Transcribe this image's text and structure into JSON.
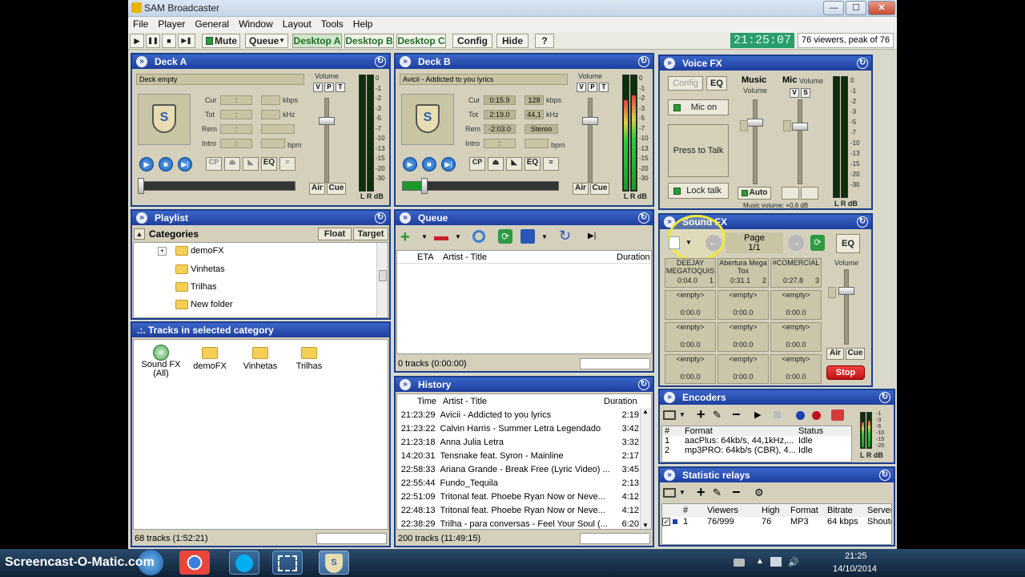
{
  "app": {
    "title": "SAM Broadcaster"
  },
  "window_controls": {
    "minimize": "—",
    "maximize": "☐",
    "close": "✕"
  },
  "menu": [
    "File",
    "Player",
    "General",
    "Window",
    "Layout",
    "Tools",
    "Help"
  ],
  "toolbar": {
    "play": "▶",
    "pause": "❚❚",
    "stop": "■",
    "next": "▶❚",
    "mute": "Mute",
    "queue": "Queue",
    "desktop_a": "Desktop A",
    "desktop_b": "Desktop B",
    "desktop_c": "Desktop C",
    "config": "Config",
    "hide": "Hide",
    "help": "?",
    "clock": "21:25:07",
    "viewers": "76 viewers, peak of 76"
  },
  "deck_a": {
    "title": "Deck A",
    "track": "Deck empty",
    "cur": ":",
    "tot": ":",
    "rem": ":",
    "intro": ":",
    "kbps_label": "kbps",
    "khz_label": "kHz",
    "bpm_label": "bpm",
    "cur_label": "Cur",
    "tot_label": "Tot",
    "rem_label": "Rem",
    "intro_label": "Intro",
    "volume_label": "Volume",
    "v": "V",
    "p": "P",
    "t": "T",
    "cp": "CP",
    "eq": "EQ",
    "air": "Air",
    "cue": "Cue"
  },
  "deck_b": {
    "title": "Deck B",
    "track": "Avicii - Addicted to you lyrics",
    "cur": "0:15.9",
    "tot": "2:19.0",
    "rem": "-2:03.0",
    "intro": ":",
    "kbps": "128",
    "khz": "44,1",
    "mode": "Stereo",
    "kbps_label": "kbps",
    "khz_label": "kHz",
    "bpm_label": "bpm",
    "cur_label": "Cur",
    "tot_label": "Tot",
    "rem_label": "Rem",
    "intro_label": "Intro",
    "volume_label": "Volume",
    "v": "V",
    "p": "P",
    "t": "T",
    "cp": "CP",
    "eq": "EQ",
    "air": "Air",
    "cue": "Cue"
  },
  "meter_scale": [
    "0",
    "-1",
    "-2",
    "-3",
    "-5",
    "-7",
    "-10",
    "-13",
    "-15",
    "-20",
    "-30"
  ],
  "meter_footer": "L R dB",
  "voice_fx": {
    "title": "Voice FX",
    "config": "Config",
    "eq": "EQ",
    "music": "Music",
    "mic": "Mic",
    "volume": "Volume",
    "v": "V",
    "s": "S",
    "mic_on": "Mic on",
    "press_to_talk": "Press to Talk",
    "lock_talk": "Lock talk",
    "auto": "Auto",
    "music_volume": "Music volume: +0,6 dB"
  },
  "playlist": {
    "title": "Playlist",
    "categories": "Categories",
    "float": "Float",
    "target": "Target",
    "items": [
      "demoFX",
      "Vinhetas",
      "Trilhas",
      "New folder"
    ]
  },
  "tracks": {
    "title": ".:. Tracks in selected category",
    "items": [
      {
        "label": "Sound FX\n(All)"
      },
      {
        "label": "demoFX"
      },
      {
        "label": "Vinhetas"
      },
      {
        "label": "Trilhas"
      }
    ],
    "status": "68 tracks (1:52:21)"
  },
  "queue": {
    "title": "Queue",
    "cols": [
      "ETA",
      "Artist - Title",
      "Duration"
    ],
    "status": "0 tracks (0:00:00)"
  },
  "history": {
    "title": "History",
    "cols": [
      "Time",
      "Artist - Title",
      "Duration"
    ],
    "rows": [
      {
        "time": "21:23:29",
        "title": "Avicii - Addicted to you lyrics",
        "dur": "2:19"
      },
      {
        "time": "21:23:22",
        "title": "Calvin Harris - Summer Letra Legendado",
        "dur": "3:42"
      },
      {
        "time": "21:23:18",
        "title": "Anna Julia Letra",
        "dur": "3:32"
      },
      {
        "time": "14:20:31",
        "title": "Tensnake feat. Syron - Mainline",
        "dur": "2:17"
      },
      {
        "time": "22:58:33",
        "title": "Ariana Grande - Break Free (Lyric Video) ...",
        "dur": "3:45"
      },
      {
        "time": "22:55:44",
        "title": "Fundo_Tequila",
        "dur": "2:13"
      },
      {
        "time": "22:51:09",
        "title": "Tritonal feat. Phoebe Ryan Now or Neve...",
        "dur": "4:12"
      },
      {
        "time": "22:48:13",
        "title": "Tritonal feat. Phoebe Ryan Now or Neve...",
        "dur": "4:12"
      },
      {
        "time": "22:38:29",
        "title": "Trilha - para conversas - Feel Your Soul (...",
        "dur": "6:20"
      }
    ],
    "status": "200 tracks (11:49:15)"
  },
  "sound_fx": {
    "title": "Sound FX",
    "page_label": "Page",
    "page": "1/1",
    "eq": "EQ",
    "volume": "Volume",
    "air": "Air",
    "cue": "Cue",
    "stop": "Stop",
    "cells": [
      {
        "name": "DEEJAY MEGATOQUIS",
        "time": "0:04.0",
        "num": "1"
      },
      {
        "name": "Abertura Mega Tox",
        "time": "0:31.1",
        "num": "2"
      },
      {
        "name": "#COMERCIAL",
        "time": "0:27.8",
        "num": "3"
      },
      {
        "name": "<empty>",
        "time": "0:00.0",
        "num": ""
      },
      {
        "name": "<empty>",
        "time": "0:00.0",
        "num": ""
      },
      {
        "name": "<empty>",
        "time": "0:00.0",
        "num": ""
      },
      {
        "name": "<empty>",
        "time": "0:00.0",
        "num": ""
      },
      {
        "name": "<empty>",
        "time": "0:00.0",
        "num": ""
      },
      {
        "name": "<empty>",
        "time": "0:00.0",
        "num": ""
      },
      {
        "name": "<empty>",
        "time": "0:00.0",
        "num": ""
      },
      {
        "name": "<empty>",
        "time": "0:00.0",
        "num": ""
      },
      {
        "name": "<empty>",
        "time": "0:00.0",
        "num": ""
      }
    ]
  },
  "encoders": {
    "title": "Encoders",
    "cols": [
      "#",
      "Format",
      "Status"
    ],
    "rows": [
      {
        "n": "1",
        "format": "aacPlus: 64kb/s, 44,1kHz,...",
        "status": "Idle"
      },
      {
        "n": "2",
        "format": "mp3PRO: 64kb/s (CBR), 4...",
        "status": "Idle"
      }
    ],
    "meter_scale": [
      "-1",
      "-3",
      "-6",
      "-10",
      "-15",
      "-20"
    ],
    "meter_footer": "L R dB"
  },
  "relays": {
    "title": "Statistic relays",
    "cols": [
      "#",
      "Viewers",
      "High",
      "Format",
      "Bitrate",
      "Server"
    ],
    "rows": [
      {
        "n": "1",
        "viewers": "76/999",
        "high": "76",
        "format": "MP3",
        "bitrate": "64 kbps",
        "server": "Shoutca"
      }
    ]
  },
  "taskbar": {
    "watermark": "Screencast-O-Matic.com",
    "time": "21:25",
    "date": "14/10/2014"
  }
}
